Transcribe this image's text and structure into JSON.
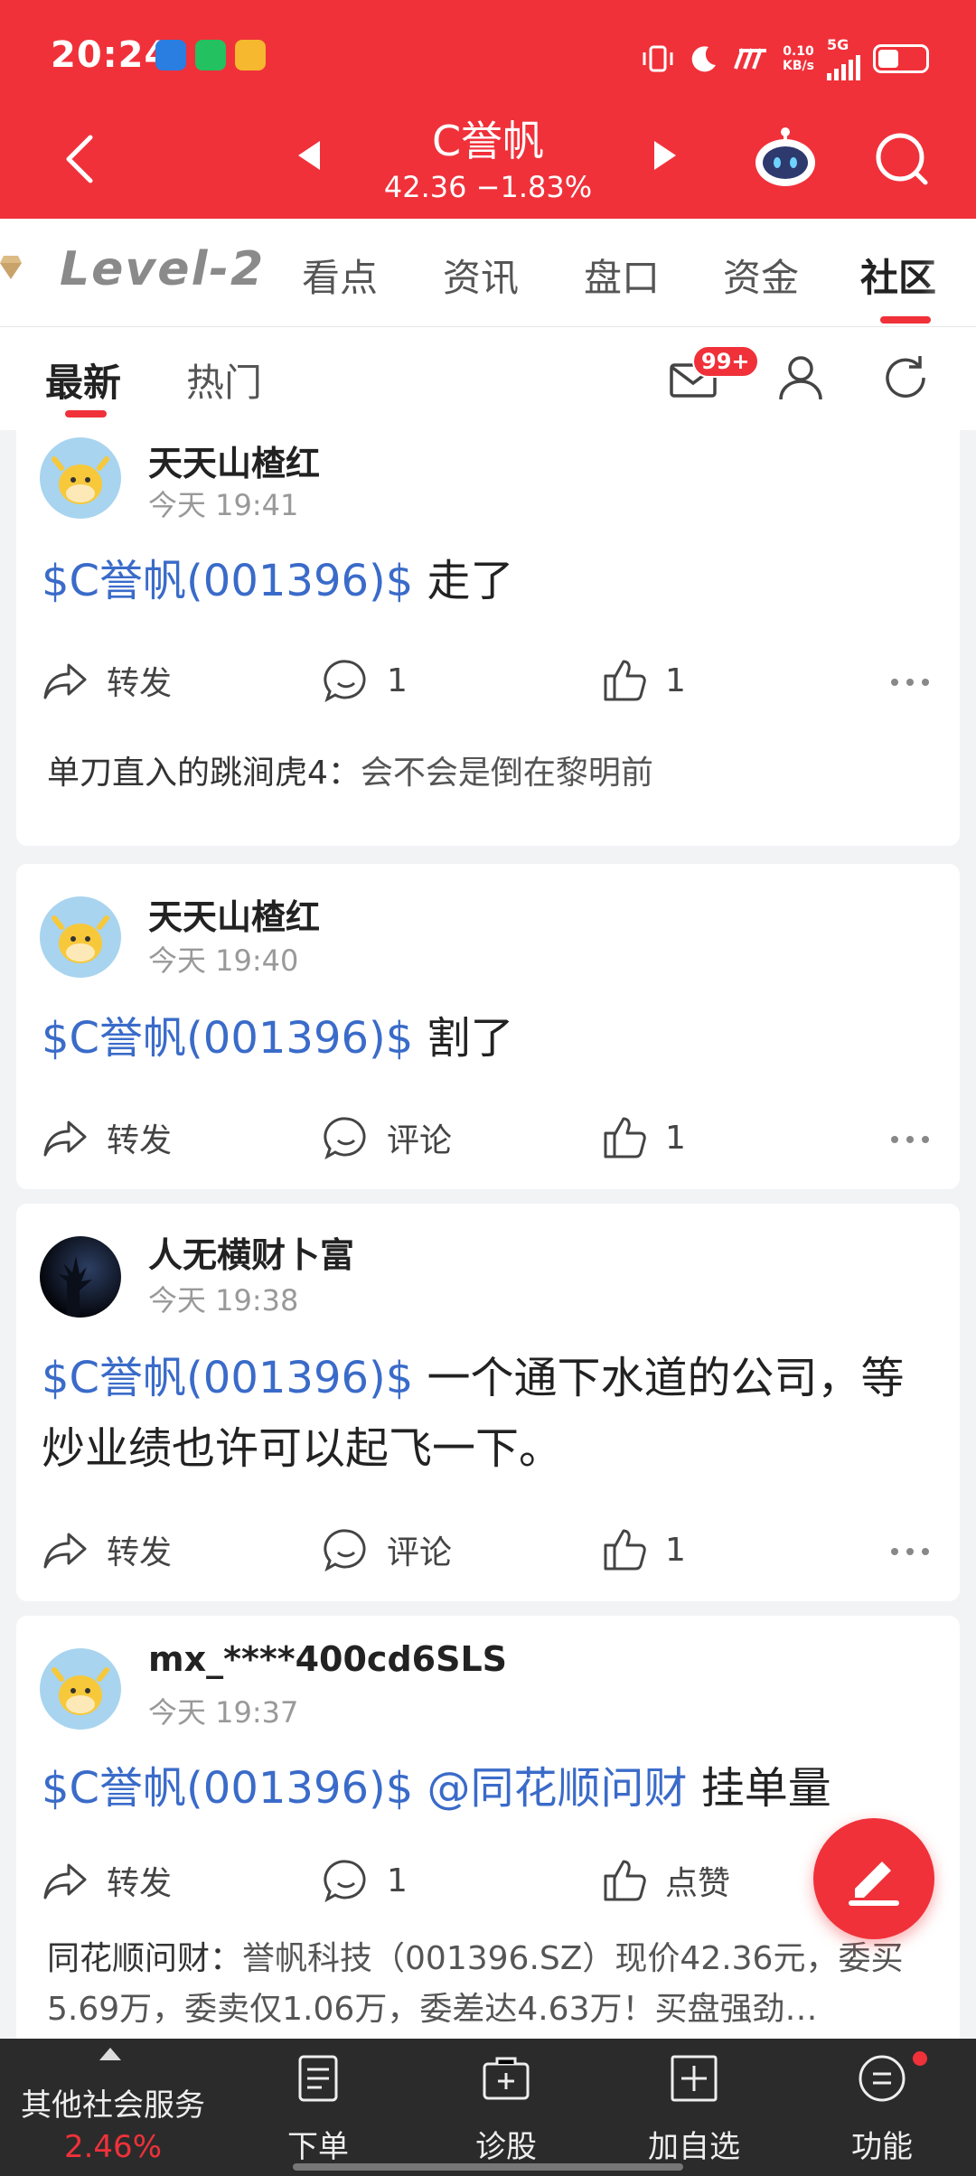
{
  "status_bar": {
    "time": "20:24",
    "net_speed_value": "0.10",
    "net_speed_unit": "KB/s",
    "network": "5G"
  },
  "nav": {
    "stock_name": "C誉帆",
    "price_change": "42.36 −1.83%"
  },
  "tabs": {
    "level2": "Level-2",
    "items": [
      "看点",
      "资讯",
      "盘口",
      "资金",
      "社区"
    ],
    "active": "社区"
  },
  "subtabs": {
    "latest": "最新",
    "hot": "热门",
    "mail_badge": "99+"
  },
  "posts": [
    {
      "user": "天天山楂红",
      "time": "今天 19:41",
      "tag": "$C誉帆(001396)$",
      "text": " 走了",
      "forward": "转发",
      "comment": "1",
      "like": "1",
      "comment_preview": {
        "who": "单刀直入的跳涧虎4：",
        "msg": "会不会是倒在黎明前"
      }
    },
    {
      "user": "天天山楂红",
      "time": "今天 19:40",
      "tag": "$C誉帆(001396)$",
      "text": " 割了",
      "forward": "转发",
      "comment": "评论",
      "like": "1"
    },
    {
      "user": "人无横财卜富",
      "time": "今天 19:38",
      "tag": "$C誉帆(001396)$",
      "text": " 一个通下水道的公司，等炒业绩也许可以起飞一下。",
      "forward": "转发",
      "comment": "评论",
      "like": "1"
    },
    {
      "user": "mx_****400cd6SLS",
      "time": "今天 19:37",
      "tag": "$C誉帆(001396)$ @同花顺问财",
      "text": " 挂单量",
      "forward": "转发",
      "comment": "1",
      "like": "点赞",
      "comment_preview": {
        "who": "同花顺问财：",
        "msg": "誉帆科技（001396.SZ）现价42.36元，委买5.69万，委卖仅1.06万，委差达4.63万！买盘强劲…"
      }
    }
  ],
  "bottom_bar": {
    "service_label": "其他社会服务",
    "service_pct": "2.46%",
    "items": [
      "下单",
      "诊股",
      "加自选",
      "功能"
    ]
  },
  "colors": {
    "brand_red": "#f0313a",
    "link_blue": "#3a6bc9",
    "bottom_bg": "#2b2b2b"
  }
}
